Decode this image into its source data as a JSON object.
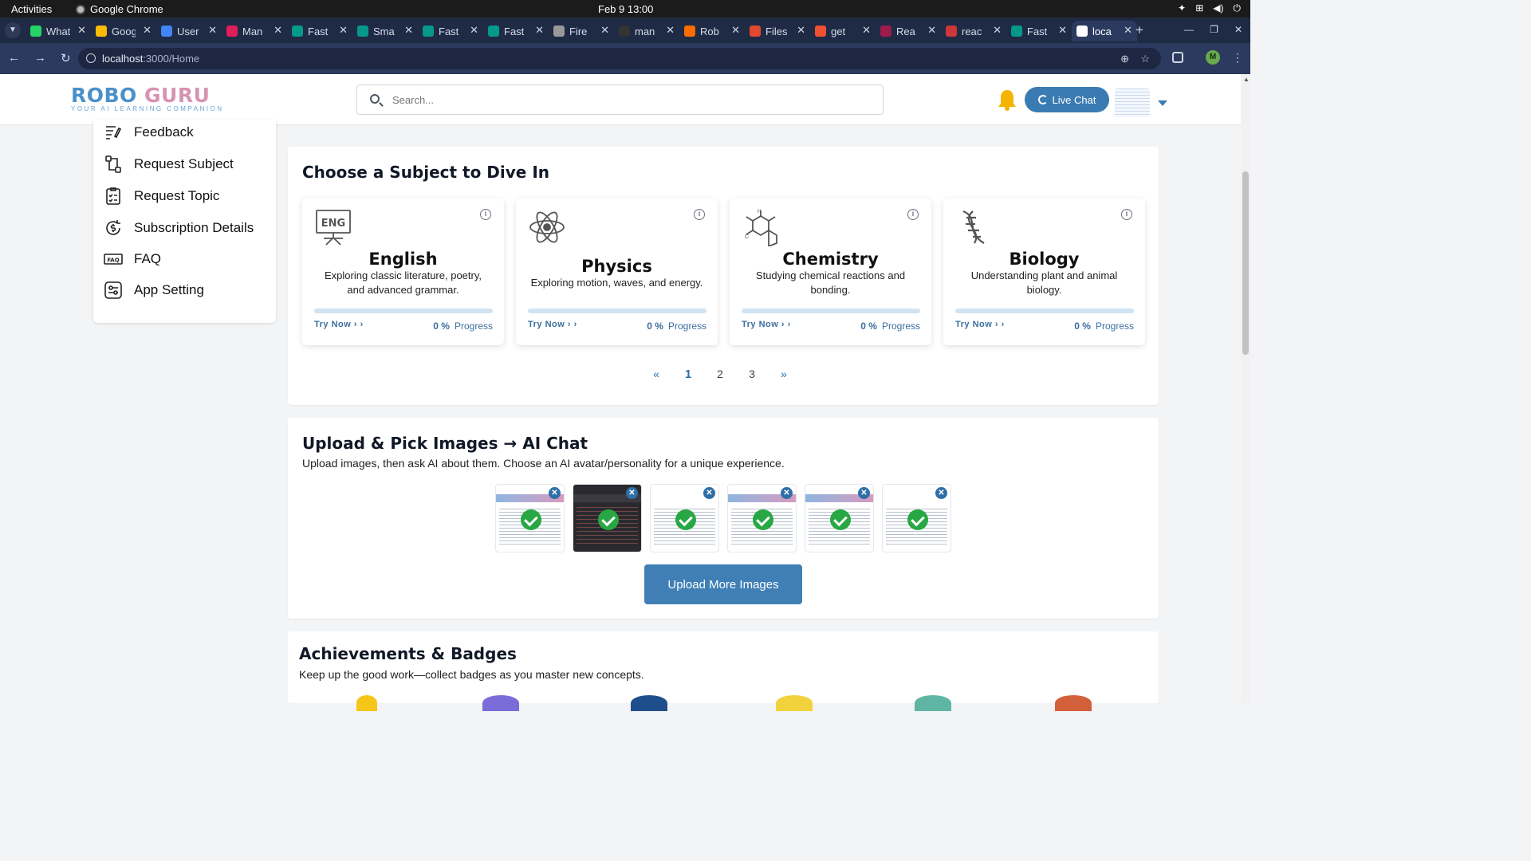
{
  "os": {
    "activities": "Activities",
    "app_name": "Google Chrome",
    "clock": "Feb 9  13:00"
  },
  "browser": {
    "tabs": [
      {
        "title": "WhatsApp",
        "color": "#25d366"
      },
      {
        "title": "Google",
        "color": "#fbbc05"
      },
      {
        "title": "User",
        "color": "#4285f4"
      },
      {
        "title": "Man",
        "color": "#e01e5a"
      },
      {
        "title": "Fast",
        "color": "#05998b"
      },
      {
        "title": "Sma",
        "color": "#05998b"
      },
      {
        "title": "Fast",
        "color": "#05998b"
      },
      {
        "title": "Fast",
        "color": "#05998b"
      },
      {
        "title": "Fire",
        "color": "#999999"
      },
      {
        "title": "man",
        "color": "#333333"
      },
      {
        "title": "Rob",
        "color": "#ff6d00"
      },
      {
        "title": "Files",
        "color": "#e2492f"
      },
      {
        "title": "get",
        "color": "#f05032"
      },
      {
        "title": "Rea",
        "color": "#9c1c4c"
      },
      {
        "title": "reac",
        "color": "#cb3837"
      },
      {
        "title": "Fast",
        "color": "#05998b"
      },
      {
        "title": "loca",
        "color": "#ffffff",
        "active": true
      }
    ],
    "url_host": "localhost",
    "url_path": ":3000/Home",
    "profile_initial": "M"
  },
  "header": {
    "logo_word1": "ROBO",
    "logo_word2": "GURU",
    "logo_tagline": "YOUR AI LEARNING COMPANION",
    "search_placeholder": "Search...",
    "live_chat_label": "Live Chat"
  },
  "sidebar": {
    "items": [
      {
        "label": "Feedback",
        "icon": "feedback-icon"
      },
      {
        "label": "Request Subject",
        "icon": "request-subject-icon"
      },
      {
        "label": "Request Topic",
        "icon": "request-topic-icon"
      },
      {
        "label": "Subscription Details",
        "icon": "subscription-icon"
      },
      {
        "label": "FAQ",
        "icon": "faq-icon"
      },
      {
        "label": "App Setting",
        "icon": "settings-icon"
      }
    ]
  },
  "subjects": {
    "title": "Choose a Subject to Dive In",
    "cards": [
      {
        "name": "English",
        "icon": "eng-easel-icon",
        "desc": "Exploring classic literature, poetry, and advanced grammar.",
        "try_label": "Try Now",
        "progress_value": "0 %",
        "progress_label": "Progress",
        "progress_fraction": 0
      },
      {
        "name": "Physics",
        "icon": "atom-icon",
        "desc": "Exploring motion, waves, and energy.",
        "try_label": "Try Now",
        "progress_value": "0 %",
        "progress_label": "Progress",
        "progress_fraction": 0
      },
      {
        "name": "Chemistry",
        "icon": "molecule-icon",
        "desc": "Studying chemical reactions and bonding.",
        "try_label": "Try Now",
        "progress_value": "0 %",
        "progress_label": "Progress",
        "progress_fraction": 0
      },
      {
        "name": "Biology",
        "icon": "dna-icon",
        "desc": "Understanding plant and animal biology.",
        "try_label": "Try Now",
        "progress_value": "0 %",
        "progress_label": "Progress",
        "progress_fraction": 0
      }
    ],
    "pagination": {
      "prev": "«",
      "pages": [
        "1",
        "2",
        "3"
      ],
      "current": "1",
      "next": "»"
    }
  },
  "upload": {
    "title": "Upload & Pick Images → AI Chat",
    "subtitle": "Upload images, then ask AI about them. Choose an AI avatar/personality for a unique experience.",
    "images": [
      {
        "style": "light",
        "selected": true
      },
      {
        "style": "dark",
        "selected": true
      },
      {
        "style": "plain",
        "selected": true
      },
      {
        "style": "light",
        "selected": true
      },
      {
        "style": "light",
        "selected": true
      },
      {
        "style": "plain",
        "selected": true
      }
    ],
    "button_label": "Upload More Images"
  },
  "achievements": {
    "title": "Achievements & Badges",
    "subtitle": "Keep up the good work—collect badges as you master new concepts."
  },
  "colors": {
    "primary": "#3b7bb3",
    "success": "#28a745",
    "logo_blue": "#4a90c9",
    "logo_pink": "#d893b2"
  }
}
